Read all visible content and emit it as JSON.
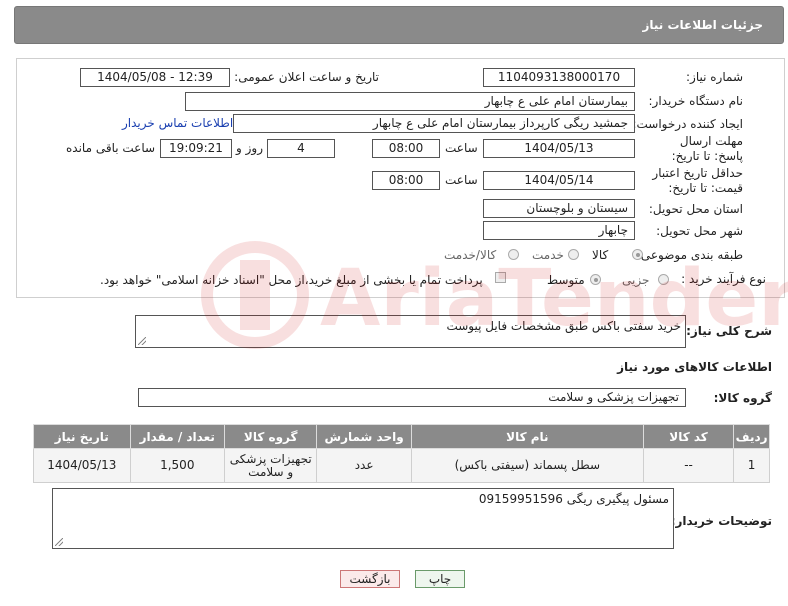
{
  "header": {
    "title": "جزئیات اطلاعات نیاز"
  },
  "form": {
    "need_number": {
      "label": "شماره نیاز:",
      "value": "1104093138000170"
    },
    "announce_datetime": {
      "label": "تاریخ و ساعت اعلان عمومی:",
      "value": "1404/05/08 - 12:39"
    },
    "buyer_org": {
      "label": "نام دستگاه خریدار:",
      "value": "بیمارستان امام علی  ع  چابهار"
    },
    "requester": {
      "label": "ایجاد کننده درخواست:",
      "value": "جمشید ریگی کارپرداز بیمارستان امام علی  ع  چابهار",
      "contact_link": "اطلاعات تماس خریدار"
    },
    "reply_deadline": {
      "label": "مهلت ارسال پاسخ: تا تاریخ:",
      "date": "1404/05/13",
      "time_label": "ساعت",
      "time": "08:00",
      "days": "4",
      "days_label": "روز و",
      "remaining": "19:09:21",
      "remaining_label": "ساعت باقی مانده"
    },
    "price_validity": {
      "label": "حداقل تاریخ اعتبار قیمت: تا تاریخ:",
      "date": "1404/05/14",
      "time_label": "ساعت",
      "time": "08:00"
    },
    "province": {
      "label": "استان محل تحویل:",
      "value": "سیستان و بلوچستان"
    },
    "city": {
      "label": "شهر محل تحویل:",
      "value": "چابهار"
    },
    "category": {
      "label": "طبقه بندی موضوعی:",
      "options": [
        "کالا",
        "خدمت",
        "کالا/خدمت"
      ],
      "selected": "کالا"
    },
    "purchase_type": {
      "label": "نوع فرآیند خرید :",
      "options": [
        "جزیی",
        "متوسط"
      ],
      "selected": "متوسط",
      "treasury_note": "پرداخت تمام یا بخشی از مبلغ خرید،از محل \"اسناد خزانه اسلامی\" خواهد بود."
    }
  },
  "description": {
    "label": "شرح کلی نیاز:",
    "value": "خرید سفتی باکس طبق مشخصات فایل پیوست"
  },
  "goods_info": {
    "title": "اطلاعات کالاهای مورد نیاز"
  },
  "goods_group": {
    "label": "گروه کالا:",
    "value": "تجهیزات پزشکی و سلامت"
  },
  "table": {
    "headers": [
      "ردیف",
      "کد کالا",
      "نام کالا",
      "واحد شمارش",
      "گروه کالا",
      "تعداد / مقدار",
      "تاریخ نیاز"
    ],
    "rows": [
      [
        "1",
        "--",
        "سطل پسماند (سیفتی باکس)",
        "عدد",
        "تجهیزات پزشکی و سلامت",
        "1,500",
        "1404/05/13"
      ]
    ]
  },
  "buyer_notes": {
    "label": "توضیحات خریدار:",
    "value": "مسئول پیگیری ریگی 09159951596"
  },
  "buttons": {
    "print": "چاپ",
    "back": "بازگشت"
  },
  "watermark": {
    "text": "AriaTender.net"
  }
}
